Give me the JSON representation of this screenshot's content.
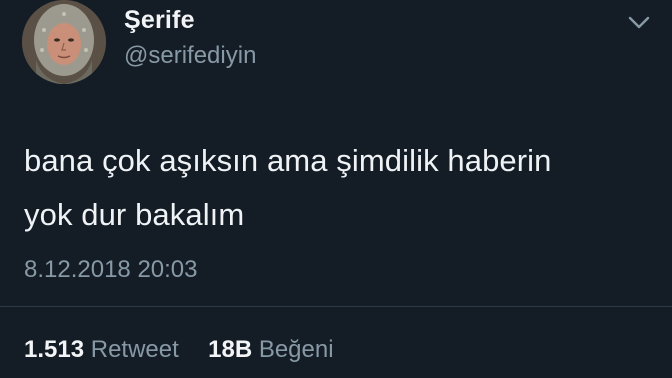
{
  "tweet": {
    "display_name": "Şerife",
    "handle": "@serifediyin",
    "text_line_1": "bana çok aşıksın ama şimdilik haberin",
    "text_line_2": "yok dur bakalım",
    "timestamp": "8.12.2018 20:03",
    "retweet_count": "1.513",
    "retweet_label": "Retweet",
    "like_count": "18B",
    "like_label": "Beğeni"
  },
  "icons": {
    "menu": "chevron-down-icon",
    "avatar": "profile-photo"
  },
  "colors": {
    "background": "#141d26",
    "primary_text": "#f0f3f5",
    "secondary_text": "#8899a6",
    "divider": "#2b3a48"
  }
}
